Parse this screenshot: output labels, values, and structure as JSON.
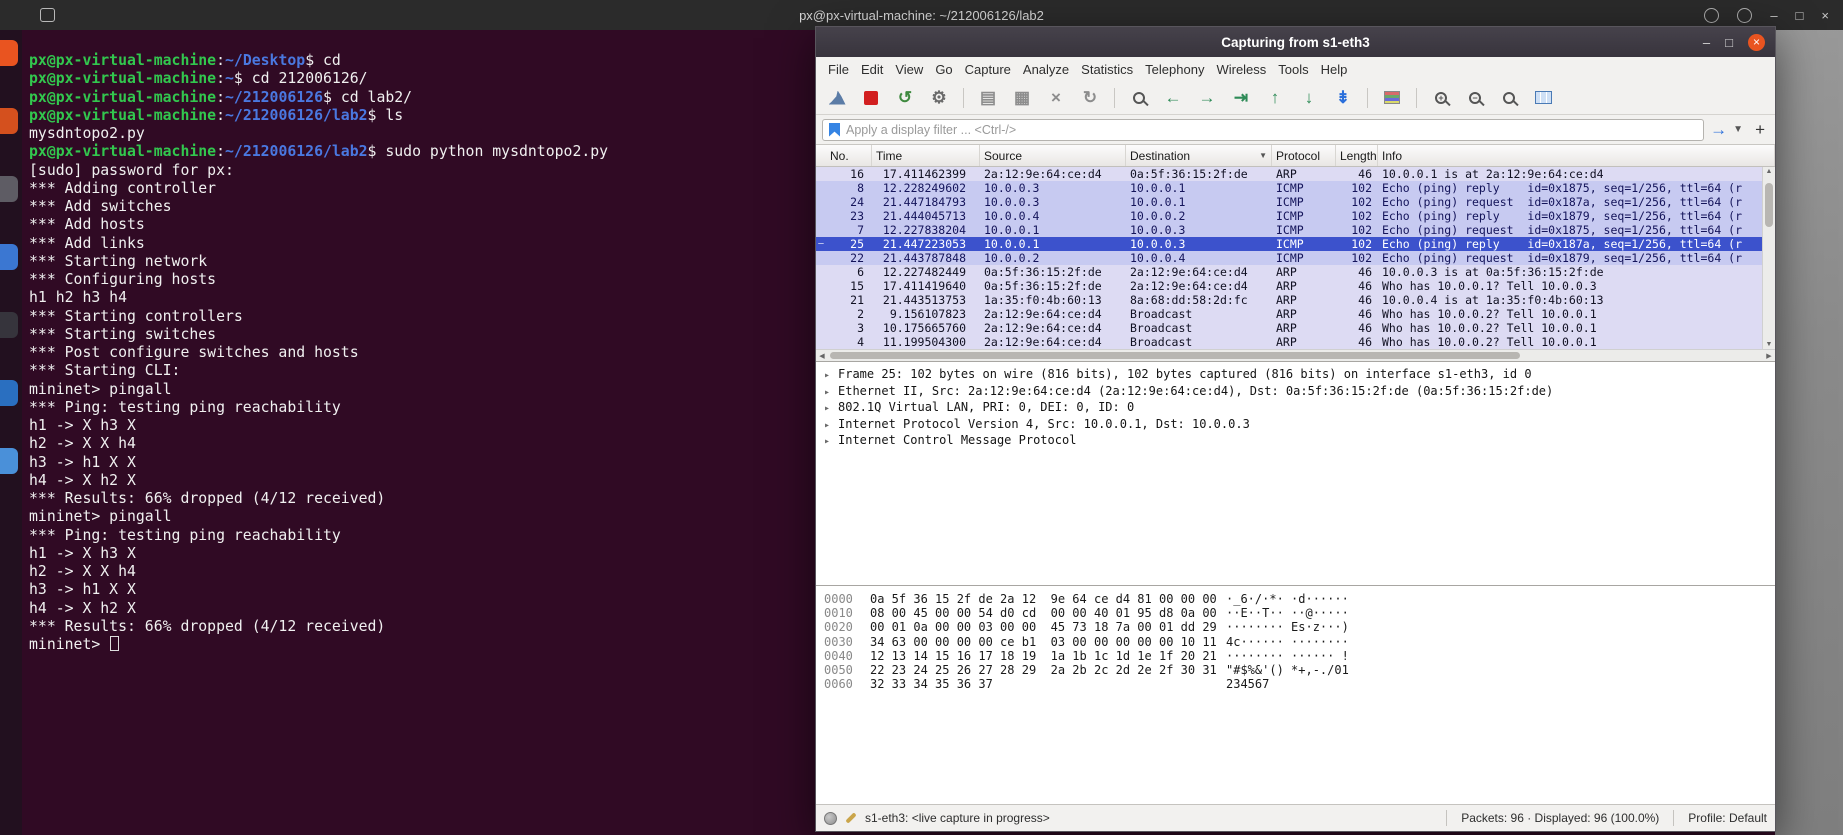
{
  "colors": {
    "accent_orange": "#e95420",
    "terminal_bg": "#300a24",
    "terminal_green": "#32c74e",
    "terminal_blue": "#4a78e0",
    "icmp_row_bg": "#c7caf1",
    "arp_row_bg": "#dddbf3",
    "selected_row_bg": "#3c52cc"
  },
  "top_bar": {
    "title": "px@px-virtual-machine: ~/212006126/lab2",
    "right_icons": [
      "search-icon",
      "window-switcher-icon"
    ],
    "window_buttons": [
      {
        "name": "minimize-button",
        "glyph": "–"
      },
      {
        "name": "restore-button",
        "glyph": "□"
      },
      {
        "name": "close-button",
        "glyph": "×"
      }
    ]
  },
  "dock": {
    "icons": [
      {
        "name": "files-app-icon",
        "color": "#e95420"
      },
      {
        "name": "firefox-app-icon",
        "color": "#d4501e"
      },
      {
        "name": "app-icon-3",
        "color": "#5e5c64"
      },
      {
        "name": "chrome-app-icon",
        "color": "#3b77d2"
      },
      {
        "name": "terminal-app-icon",
        "color": "#36343c"
      },
      {
        "name": "libreoffice-app-icon",
        "color": "#2a6fc0"
      },
      {
        "name": "app-icon-7",
        "color": "#4a90d9"
      }
    ]
  },
  "terminal": {
    "host": "px@px-virtual-machine",
    "lines": [
      {
        "path": "~/Desktop",
        "cmd": "cd"
      },
      {
        "path": "~",
        "cmd": "cd 212006126/"
      },
      {
        "path": "~/212006126",
        "cmd": "cd lab2/"
      },
      {
        "path": "~/212006126/lab2",
        "cmd": "ls"
      },
      {
        "out": "mysdntopo2.py"
      },
      {
        "path": "~/212006126/lab2",
        "cmd": "sudo python mysdntopo2.py"
      },
      {
        "out": "[sudo] password for px:"
      },
      {
        "out": "*** Adding controller"
      },
      {
        "out": "*** Add switches"
      },
      {
        "out": "*** Add hosts"
      },
      {
        "out": "*** Add links"
      },
      {
        "out": "*** Starting network"
      },
      {
        "out": "*** Configuring hosts"
      },
      {
        "out": "h1 h2 h3 h4"
      },
      {
        "out": "*** Starting controllers"
      },
      {
        "out": "*** Starting switches"
      },
      {
        "out": "*** Post configure switches and hosts"
      },
      {
        "out": "*** Starting CLI:"
      },
      {
        "out": "mininet> pingall"
      },
      {
        "out": "*** Ping: testing ping reachability"
      },
      {
        "out": "h1 -> X h3 X"
      },
      {
        "out": "h2 -> X X h4"
      },
      {
        "out": "h3 -> h1 X X"
      },
      {
        "out": "h4 -> X h2 X"
      },
      {
        "out": "*** Results: 66% dropped (4/12 received)"
      },
      {
        "out": "mininet> pingall"
      },
      {
        "out": "*** Ping: testing ping reachability"
      },
      {
        "out": "h1 -> X h3 X"
      },
      {
        "out": "h2 -> X X h4"
      },
      {
        "out": "h3 -> h1 X X"
      },
      {
        "out": "h4 -> X h2 X"
      },
      {
        "out": "*** Results: 66% dropped (4/12 received)"
      },
      {
        "out": "mininet> ",
        "cursor": true
      }
    ]
  },
  "wireshark": {
    "title": "Capturing from s1-eth3",
    "window_controls": [
      {
        "name": "minimize-button",
        "glyph": "–",
        "style": "plain"
      },
      {
        "name": "maximize-button",
        "glyph": "□",
        "style": "plain"
      },
      {
        "name": "close-button",
        "glyph": "×",
        "style": "orange-circle"
      }
    ],
    "menu": [
      "File",
      "Edit",
      "View",
      "Go",
      "Capture",
      "Analyze",
      "Statistics",
      "Telephony",
      "Wireless",
      "Tools",
      "Help"
    ],
    "toolbar": [
      {
        "name": "start-capture-icon",
        "shape": "fin",
        "color": "#5b7ca6"
      },
      {
        "name": "stop-capture-icon",
        "shape": "square",
        "color": "#d21f1f"
      },
      {
        "name": "restart-capture-icon",
        "shape": "glyph",
        "glyph": "↺",
        "color": "#3f8a3f"
      },
      {
        "name": "capture-options-icon",
        "shape": "glyph",
        "glyph": "⚙",
        "color": "#6a6a6a"
      },
      {
        "name": "separator-1",
        "shape": "sep"
      },
      {
        "name": "open-file-icon",
        "shape": "glyph",
        "glyph": "▤",
        "color": "#8d8d8d"
      },
      {
        "name": "save-file-icon",
        "shape": "glyph",
        "glyph": "▦",
        "color": "#8d8d8d"
      },
      {
        "name": "close-file-icon",
        "shape": "glyph",
        "glyph": "×",
        "color": "#8d8d8d"
      },
      {
        "name": "reload-file-icon",
        "shape": "glyph",
        "glyph": "↻",
        "color": "#8d8d8d"
      },
      {
        "name": "separator-2",
        "shape": "sep"
      },
      {
        "name": "find-packet-icon",
        "shape": "mag",
        "glyph": "",
        "color": "#555555"
      },
      {
        "name": "go-back-icon",
        "shape": "glyph",
        "glyph": "←",
        "color": "#2e8b57"
      },
      {
        "name": "go-forward-icon",
        "shape": "glyph",
        "glyph": "→",
        "color": "#2e8b57"
      },
      {
        "name": "go-to-packet-icon",
        "shape": "glyph",
        "glyph": "⇥",
        "color": "#2e8b57"
      },
      {
        "name": "go-first-packet-icon",
        "shape": "glyph",
        "glyph": "↑",
        "color": "#2e8b57"
      },
      {
        "name": "go-last-packet-icon",
        "shape": "glyph",
        "glyph": "↓",
        "color": "#2e8b57"
      },
      {
        "name": "auto-scroll-icon",
        "shape": "glyph",
        "glyph": "⇟",
        "color": "#2a6fdb"
      },
      {
        "name": "separator-3",
        "shape": "sep"
      },
      {
        "name": "colorize-icon",
        "shape": "colorize"
      },
      {
        "name": "separator-4",
        "shape": "sep"
      },
      {
        "name": "zoom-in-icon",
        "shape": "mag",
        "glyph": "+",
        "color": "#555555"
      },
      {
        "name": "zoom-out-icon",
        "shape": "mag",
        "glyph": "−",
        "color": "#555555"
      },
      {
        "name": "zoom-reset-icon",
        "shape": "mag",
        "glyph": "",
        "color": "#555555"
      },
      {
        "name": "resize-columns-icon",
        "shape": "columns",
        "color": "#3b6fb5"
      }
    ],
    "filter": {
      "placeholder": "Apply a display filter ... <Ctrl-/>"
    },
    "columns": [
      {
        "label": "No.",
        "key": "no"
      },
      {
        "label": "Time",
        "key": "time"
      },
      {
        "label": "Source",
        "key": "source"
      },
      {
        "label": "Destination",
        "key": "destination"
      },
      {
        "label": "Protocol",
        "key": "protocol"
      },
      {
        "label": "Length",
        "key": "length"
      },
      {
        "label": "Info",
        "key": "info"
      }
    ],
    "packets": [
      {
        "no": "16",
        "time": "17.411462399",
        "source": "2a:12:9e:64:ce:d4",
        "destination": "0a:5f:36:15:2f:de",
        "protocol": "ARP",
        "length": "46",
        "info": "10.0.0.1 is at 2a:12:9e:64:ce:d4",
        "kind": "arp"
      },
      {
        "no": "8",
        "time": "12.228249602",
        "source": "10.0.0.3",
        "destination": "10.0.0.1",
        "protocol": "ICMP",
        "length": "102",
        "info": "Echo (ping) reply    id=0x1875, seq=1/256, ttl=64 (r",
        "kind": "icmp"
      },
      {
        "no": "24",
        "time": "21.447184793",
        "source": "10.0.0.3",
        "destination": "10.0.0.1",
        "protocol": "ICMP",
        "length": "102",
        "info": "Echo (ping) request  id=0x187a, seq=1/256, ttl=64 (r",
        "kind": "icmp"
      },
      {
        "no": "23",
        "time": "21.444045713",
        "source": "10.0.0.4",
        "destination": "10.0.0.2",
        "protocol": "ICMP",
        "length": "102",
        "info": "Echo (ping) reply    id=0x1879, seq=1/256, ttl=64 (r",
        "kind": "icmp"
      },
      {
        "no": "7",
        "time": "12.227838204",
        "source": "10.0.0.1",
        "destination": "10.0.0.3",
        "protocol": "ICMP",
        "length": "102",
        "info": "Echo (ping) request  id=0x1875, seq=1/256, ttl=64 (r",
        "kind": "icmp"
      },
      {
        "no": "25",
        "time": "21.447223053",
        "source": "10.0.0.1",
        "destination": "10.0.0.3",
        "protocol": "ICMP",
        "length": "102",
        "info": "Echo (ping) reply    id=0x187a, seq=1/256, ttl=64 (r",
        "kind": "icmp",
        "selected": true
      },
      {
        "no": "22",
        "time": "21.443787848",
        "source": "10.0.0.2",
        "destination": "10.0.0.4",
        "protocol": "ICMP",
        "length": "102",
        "info": "Echo (ping) request  id=0x1879, seq=1/256, ttl=64 (r",
        "kind": "icmp"
      },
      {
        "no": "6",
        "time": "12.227482449",
        "source": "0a:5f:36:15:2f:de",
        "destination": "2a:12:9e:64:ce:d4",
        "protocol": "ARP",
        "length": "46",
        "info": "10.0.0.3 is at 0a:5f:36:15:2f:de",
        "kind": "arp"
      },
      {
        "no": "15",
        "time": "17.411419640",
        "source": "0a:5f:36:15:2f:de",
        "destination": "2a:12:9e:64:ce:d4",
        "protocol": "ARP",
        "length": "46",
        "info": "Who has 10.0.0.1? Tell 10.0.0.3",
        "kind": "arp"
      },
      {
        "no": "21",
        "time": "21.443513753",
        "source": "1a:35:f0:4b:60:13",
        "destination": "8a:68:dd:58:2d:fc",
        "protocol": "ARP",
        "length": "46",
        "info": "10.0.0.4 is at 1a:35:f0:4b:60:13",
        "kind": "arp"
      },
      {
        "no": "2",
        "time": "9.156107823",
        "source": "2a:12:9e:64:ce:d4",
        "destination": "Broadcast",
        "protocol": "ARP",
        "length": "46",
        "info": "Who has 10.0.0.2? Tell 10.0.0.1",
        "kind": "arp"
      },
      {
        "no": "3",
        "time": "10.175665760",
        "source": "2a:12:9e:64:ce:d4",
        "destination": "Broadcast",
        "protocol": "ARP",
        "length": "46",
        "info": "Who has 10.0.0.2? Tell 10.0.0.1",
        "kind": "arp"
      },
      {
        "no": "4",
        "time": "11.199504300",
        "source": "2a:12:9e:64:ce:d4",
        "destination": "Broadcast",
        "protocol": "ARP",
        "length": "46",
        "info": "Who has 10.0.0.2? Tell 10.0.0.1",
        "kind": "arp"
      }
    ],
    "details": [
      "Frame 25: 102 bytes on wire (816 bits), 102 bytes captured (816 bits) on interface s1-eth3, id 0",
      "Ethernet II, Src: 2a:12:9e:64:ce:d4 (2a:12:9e:64:ce:d4), Dst: 0a:5f:36:15:2f:de (0a:5f:36:15:2f:de)",
      "802.1Q Virtual LAN, PRI: 0, DEI: 0, ID: 0",
      "Internet Protocol Version 4, Src: 10.0.0.1, Dst: 10.0.0.3",
      "Internet Control Message Protocol"
    ],
    "hex_rows": [
      {
        "off": "0000",
        "hex": "0a 5f 36 15 2f de 2a 12  9e 64 ce d4 81 00 00 00",
        "ascii": "·_6·/·*· ·d······"
      },
      {
        "off": "0010",
        "hex": "08 00 45 00 00 54 d0 cd  00 00 40 01 95 d8 0a 00",
        "ascii": "··E··T·· ··@·····"
      },
      {
        "off": "0020",
        "hex": "00 01 0a 00 00 03 00 00  45 73 18 7a 00 01 dd 29",
        "ascii": "········ Es·z···)"
      },
      {
        "off": "0030",
        "hex": "34 63 00 00 00 00 ce b1  03 00 00 00 00 00 10 11",
        "ascii": "4c······ ········"
      },
      {
        "off": "0040",
        "hex": "12 13 14 15 16 17 18 19  1a 1b 1c 1d 1e 1f 20 21",
        "ascii": "········ ······ !"
      },
      {
        "off": "0050",
        "hex": "22 23 24 25 26 27 28 29  2a 2b 2c 2d 2e 2f 30 31",
        "ascii": "\"#$%&'() *+,-./01"
      },
      {
        "off": "0060",
        "hex": "32 33 34 35 36 37",
        "ascii": "234567"
      }
    ],
    "status": {
      "capture": "s1-eth3: <live capture in progress>",
      "packets": "Packets: 96 · Displayed: 96 (100.0%)",
      "profile": "Profile: Default"
    }
  }
}
